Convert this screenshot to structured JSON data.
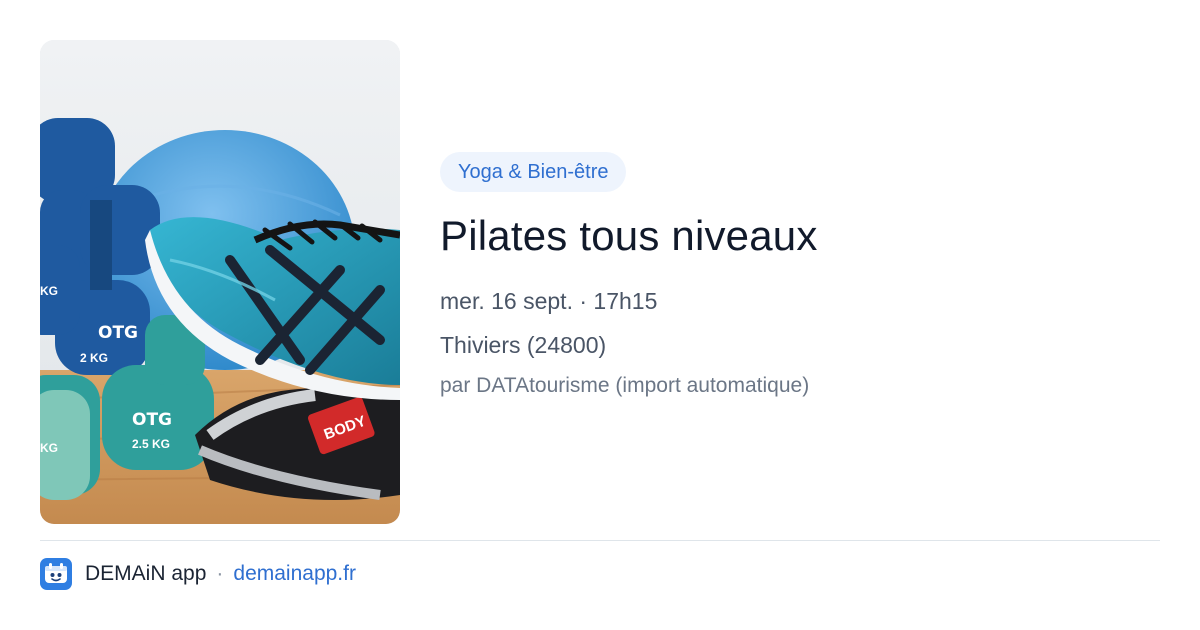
{
  "event": {
    "image_alt": "Haltères, chaussure de sport et ballon de gym",
    "image_text": {
      "weight_small": "2 KG",
      "weight_medium": "2.5 KG",
      "weight_partial": "KG",
      "brand": "BODY"
    },
    "category": "Yoga & Bien-être",
    "title": "Pilates tous niveaux",
    "datetime": "mer. 16 sept. · 17h15",
    "location": "Thiviers (24800)",
    "source": "par DATAtourisme (import automatique)"
  },
  "footer": {
    "logo_icon": "demain-logo-icon",
    "app_name": "DEMAiN app",
    "separator": "·",
    "site": "demainapp.fr"
  },
  "colors": {
    "accent": "#2f6fd0",
    "badge_bg": "#eef4fd",
    "title": "#111a2b",
    "body": "#4a5566",
    "muted": "#6b7686",
    "logo_bg": "#2f7ee2"
  }
}
